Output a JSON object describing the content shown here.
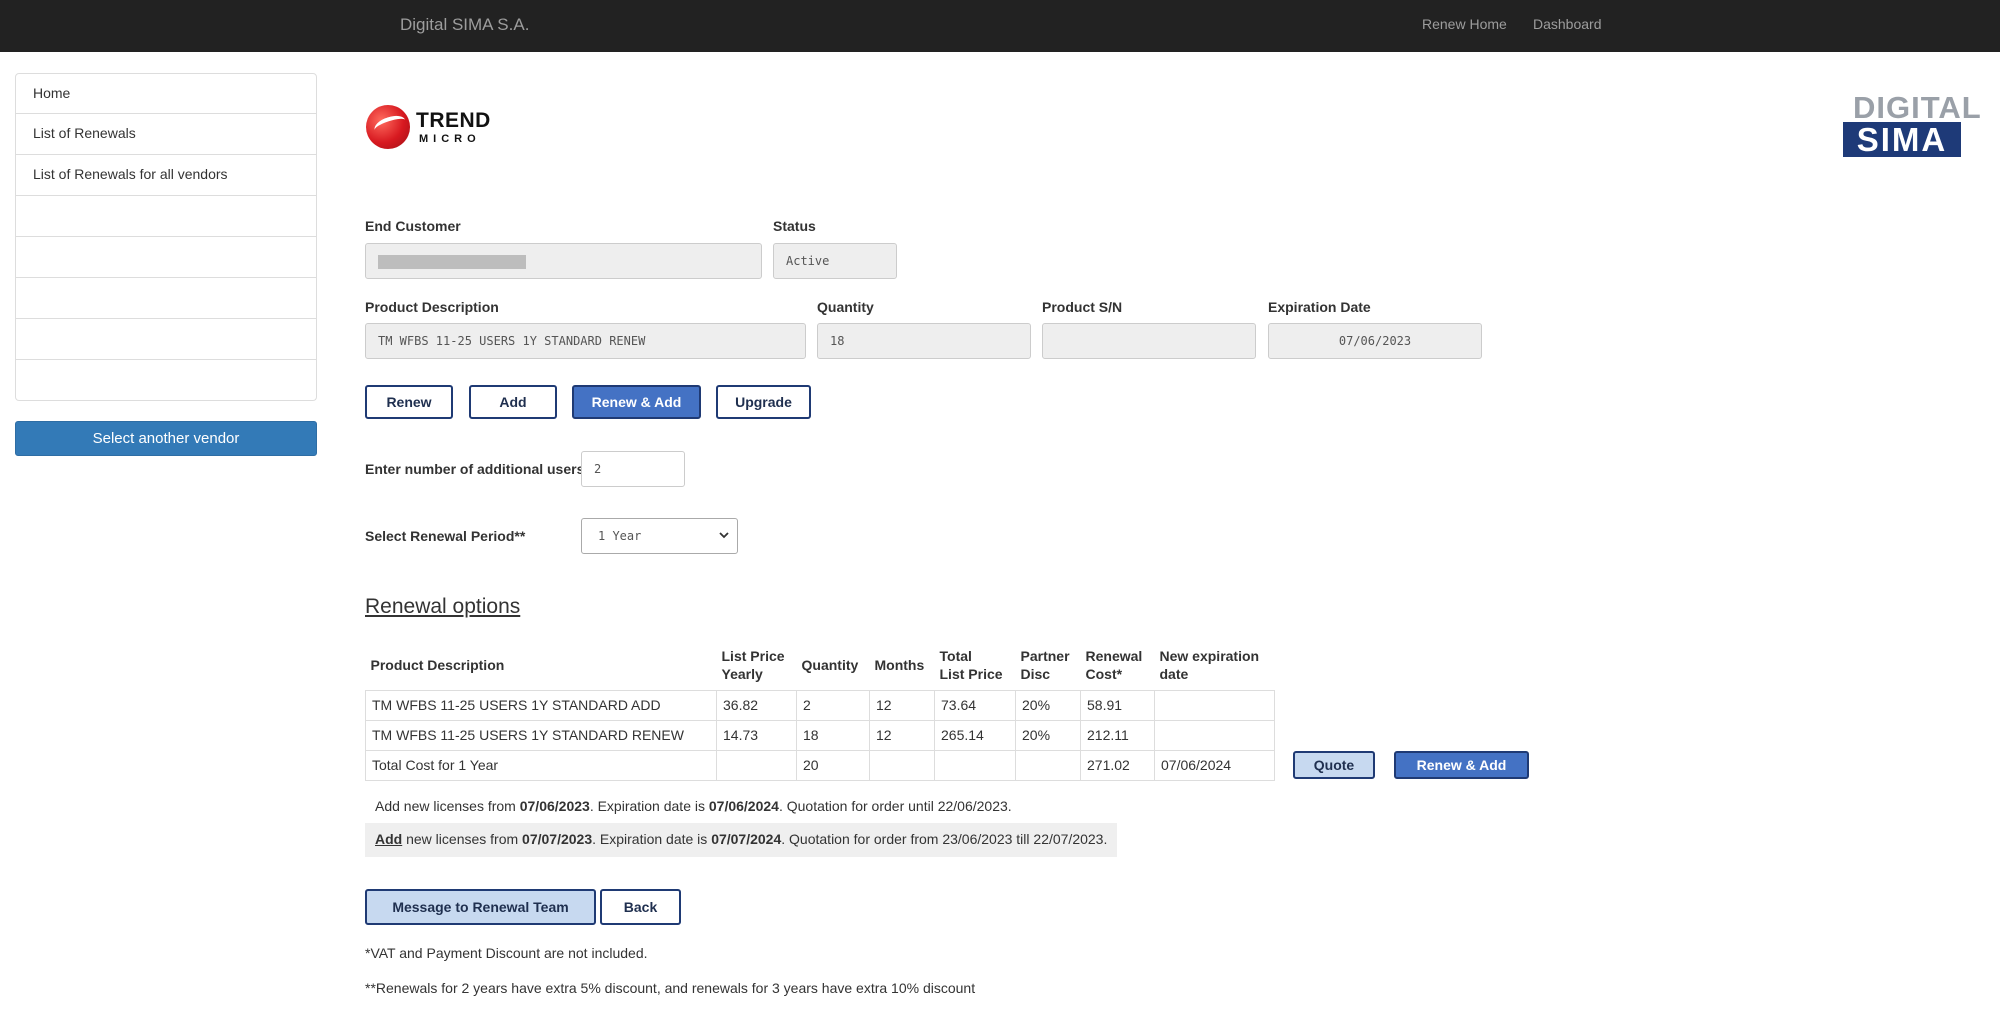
{
  "navbar": {
    "brand": "Digital SIMA S.A.",
    "links": [
      "Renew Home",
      "Dashboard"
    ]
  },
  "sidebar": {
    "items": [
      "Home",
      "List of Renewals",
      "List of Renewals for all vendors",
      "",
      "",
      "",
      "",
      ""
    ],
    "vendor_button": "Select another vendor"
  },
  "logos": {
    "vendor_line1": "TREND",
    "vendor_line2": "MICRO",
    "company_line1": "DIGITAL",
    "company_line2": "SIMA"
  },
  "form": {
    "end_customer_label": "End Customer",
    "status_label": "Status",
    "status_value": "Active",
    "product_description_label": "Product Description",
    "product_description_value": "TM WFBS 11-25 USERS 1Y STANDARD RENEW",
    "quantity_label": "Quantity",
    "quantity_value": "18",
    "product_sn_label": "Product S/N",
    "product_sn_value": "",
    "expiration_label": "Expiration Date",
    "expiration_value": "07/06/2023"
  },
  "actions": {
    "renew": "Renew",
    "add": "Add",
    "renew_add": "Renew & Add",
    "upgrade": "Upgrade"
  },
  "additional_users": {
    "label": "Enter number of additional users",
    "value": "2"
  },
  "renewal_period": {
    "label": "Select Renewal Period**",
    "selected": "1 Year"
  },
  "renewal_options": {
    "title": "Renewal options",
    "headers": [
      [
        "Product Description"
      ],
      [
        "List Price",
        "Yearly"
      ],
      [
        "Quantity"
      ],
      [
        "Months"
      ],
      [
        "Total",
        "List Price"
      ],
      [
        "Partner",
        "Disc"
      ],
      [
        "Renewal",
        "Cost*"
      ],
      [
        "New expiration",
        "date"
      ]
    ],
    "rows": [
      [
        "TM WFBS 11-25 USERS 1Y STANDARD ADD",
        "36.82",
        "2",
        "12",
        "73.64",
        "20%",
        "58.91",
        ""
      ],
      [
        "TM WFBS 11-25 USERS 1Y STANDARD RENEW",
        "14.73",
        "18",
        "12",
        "265.14",
        "20%",
        "212.11",
        ""
      ],
      [
        "Total Cost for 1 Year",
        "",
        "20",
        "",
        "",
        "",
        "271.02",
        "07/06/2024"
      ]
    ],
    "quote_button": "Quote",
    "renew_add_button": "Renew & Add"
  },
  "messages": {
    "msg1": {
      "t1": "Add new licenses from ",
      "b1": "07/06/2023",
      "t2": ". Expiration date is ",
      "b2": "07/06/2024",
      "t3": ". Quotation for order until 22/06/2023."
    },
    "msg2": {
      "link": "Add",
      "t1": " new licenses from ",
      "b1": "07/07/2023",
      "t2": ". Expiration date is ",
      "b2": "07/07/2024",
      "t3": ". Quotation for order from 23/06/2023 till 22/07/2023."
    }
  },
  "footer_buttons": {
    "message": "Message to Renewal Team",
    "back": "Back"
  },
  "notes": {
    "vat": "*VAT and Payment Discount are not included.",
    "discount": "**Renewals for 2 years have extra 5% discount, and renewals for 3 years have extra 10% discount"
  }
}
